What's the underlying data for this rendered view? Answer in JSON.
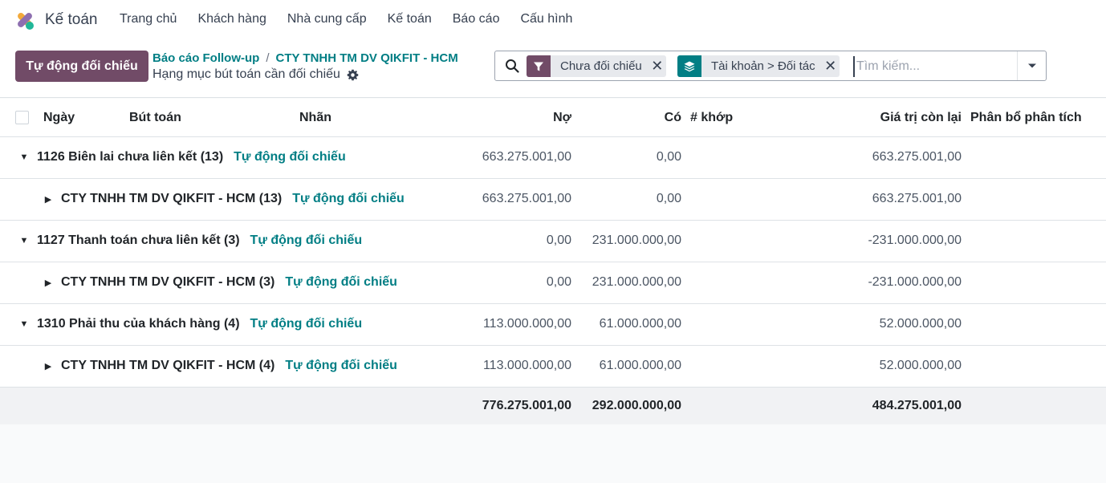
{
  "app": {
    "name": "Kế toán"
  },
  "menu": [
    "Trang chủ",
    "Khách hàng",
    "Nhà cung cấp",
    "Kế toán",
    "Báo cáo",
    "Cấu hình"
  ],
  "control_panel": {
    "primary_button": "Tự động đối chiếu",
    "breadcrumb": {
      "parent": "Báo cáo Follow-up",
      "separator": "/",
      "current": "CTY TNHH TM DV QIKFIT - HCM"
    },
    "subtitle": "Hạng mục bút toán cần đối chiếu"
  },
  "search": {
    "facets": [
      {
        "icon": "filter-icon",
        "label": "Chưa đối chiếu",
        "color": "#714b67"
      },
      {
        "icon": "layers-icon",
        "label": "Tài khoản > Đối tác",
        "color": "#017e84"
      }
    ],
    "placeholder": "Tìm kiếm..."
  },
  "table": {
    "columns": {
      "date": "Ngày",
      "entry": "Bút toán",
      "label": "Nhãn",
      "debit": "Nợ",
      "credit": "Có",
      "matching": "# khớp",
      "residual": "Giá trị còn lại",
      "analytic": "Phân bổ phân tích"
    },
    "rows": [
      {
        "level": 1,
        "label": "1126 Biên lai chưa liên kết (13)",
        "action": "Tự động đối chiếu",
        "debit": "663.275.001,00",
        "credit": "0,00",
        "residual": "663.275.001,00"
      },
      {
        "level": 2,
        "label": "CTY TNHH TM DV QIKFIT - HCM (13)",
        "action": "Tự động đối chiếu",
        "debit": "663.275.001,00",
        "credit": "0,00",
        "residual": "663.275.001,00"
      },
      {
        "level": 1,
        "label": "1127 Thanh toán chưa liên kết (3)",
        "action": "Tự động đối chiếu",
        "debit": "0,00",
        "credit": "231.000.000,00",
        "residual": "-231.000.000,00"
      },
      {
        "level": 2,
        "label": "CTY TNHH TM DV QIKFIT - HCM (3)",
        "action": "Tự động đối chiếu",
        "debit": "0,00",
        "credit": "231.000.000,00",
        "residual": "-231.000.000,00"
      },
      {
        "level": 1,
        "label": "1310 Phải thu của khách hàng (4)",
        "action": "Tự động đối chiếu",
        "debit": "113.000.000,00",
        "credit": "61.000.000,00",
        "residual": "52.000.000,00"
      },
      {
        "level": 2,
        "label": "CTY TNHH TM DV QIKFIT - HCM (4)",
        "action": "Tự động đối chiếu",
        "debit": "113.000.000,00",
        "credit": "61.000.000,00",
        "residual": "52.000.000,00"
      }
    ],
    "totals": {
      "debit": "776.275.001,00",
      "credit": "292.000.000,00",
      "residual": "484.275.001,00"
    }
  },
  "colors": {
    "primary": "#714b67",
    "link": "#017e84"
  }
}
